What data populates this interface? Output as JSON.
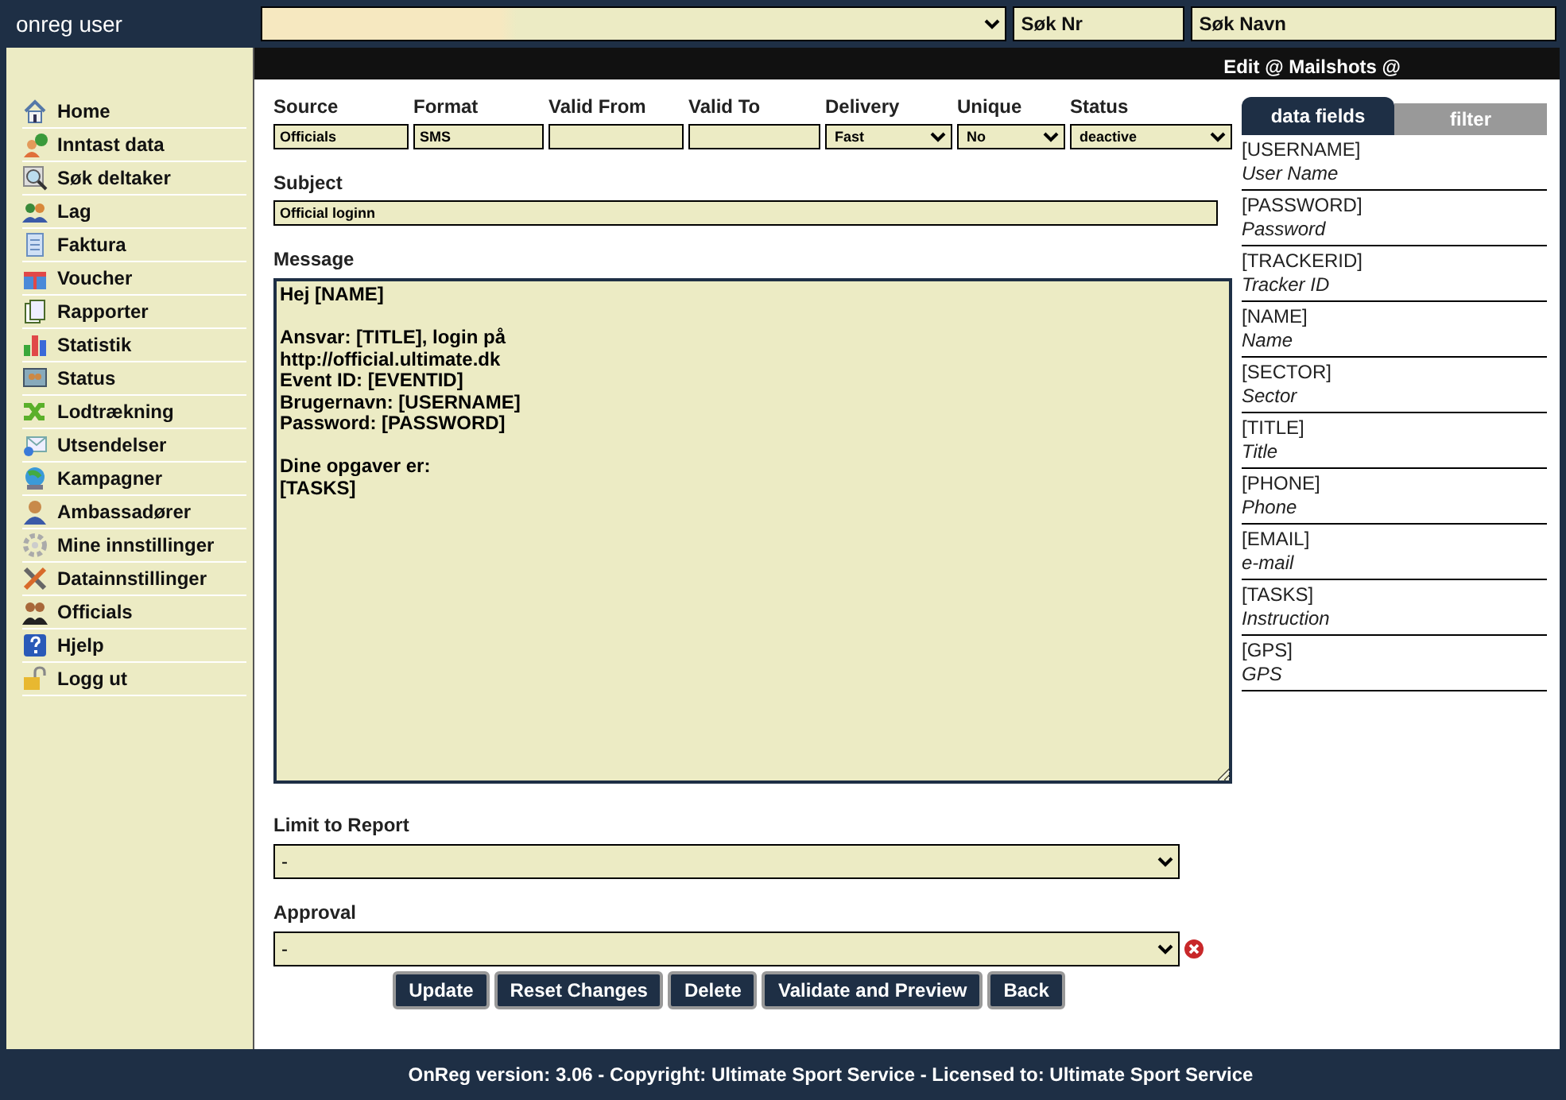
{
  "header": {
    "user": "onreg user",
    "search_number": {
      "placeholder": "Søk Nr"
    },
    "search_name": {
      "placeholder": "Søk Navn"
    }
  },
  "sidebar": {
    "items": [
      {
        "label": "Home"
      },
      {
        "label": "Inntast data"
      },
      {
        "label": "Søk deltaker"
      },
      {
        "label": "Lag"
      },
      {
        "label": "Faktura"
      },
      {
        "label": "Voucher"
      },
      {
        "label": "Rapporter"
      },
      {
        "label": "Statistik"
      },
      {
        "label": "Status"
      },
      {
        "label": "Lodtrækning"
      },
      {
        "label": "Utsendelser"
      },
      {
        "label": "Kampagner"
      },
      {
        "label": "Ambassadører"
      },
      {
        "label": "Mine innstillinger"
      },
      {
        "label": "Datainnstillinger"
      },
      {
        "label": "Officials"
      },
      {
        "label": "Hjelp"
      },
      {
        "label": "Logg ut"
      }
    ]
  },
  "page_title": "Edit @ Mailshots @",
  "fields": [
    {
      "label": "Source",
      "kind": "text",
      "value": "Officials"
    },
    {
      "label": "Format",
      "kind": "text",
      "value": "SMS"
    },
    {
      "label": "Valid From",
      "kind": "text"
    },
    {
      "label": "Valid To",
      "kind": "text"
    },
    {
      "label": "Delivery",
      "kind": "select",
      "value": "Fast"
    },
    {
      "label": "Unique",
      "kind": "select",
      "value": "No"
    },
    {
      "label": "Status",
      "kind": "select",
      "value": "deactive"
    }
  ],
  "subject": {
    "label": "Subject",
    "value": "Official loginn"
  },
  "message": {
    "label": "Message",
    "value": "Hej [NAME]\n\nAnsvar: [TITLE], login på\nhttp://official.ultimate.dk\nEvent ID: [EVENTID]\nBrugernavn: [USERNAME]\nPassword: [PASSWORD]\n\nDine opgaver er:\n[TASKS]\n"
  },
  "limit_to_report": {
    "label": "Limit to Report",
    "value": "-"
  },
  "approval": {
    "label": "Approval",
    "value": "-",
    "error": true
  },
  "buttons": [
    "Update",
    "Reset Changes",
    "Delete",
    "Validate and Preview",
    "Back"
  ],
  "tabs": [
    {
      "label": "data fields",
      "selected": true
    },
    {
      "label": "filter",
      "selected": false
    }
  ],
  "data_fields": [
    {
      "code": "[USERNAME]",
      "description": "User Name"
    },
    {
      "code": "[PASSWORD]",
      "description": "Password"
    },
    {
      "code": "[TRACKERID]",
      "description": "Tracker ID"
    },
    {
      "code": "[NAME]",
      "description": "Name"
    },
    {
      "code": "[SECTOR]",
      "description": "Sector"
    },
    {
      "code": "[TITLE]",
      "description": "Title"
    },
    {
      "code": "[PHONE]",
      "description": "Phone"
    },
    {
      "code": "[EMAIL]",
      "description": "e-mail"
    },
    {
      "code": "[TASKS]",
      "description": "Instruction"
    },
    {
      "code": "[GPS]",
      "description": "GPS"
    }
  ],
  "footer": "OnReg version: 3.06 - Copyright: Ultimate Sport Service - Licensed to: Ultimate Sport Service"
}
